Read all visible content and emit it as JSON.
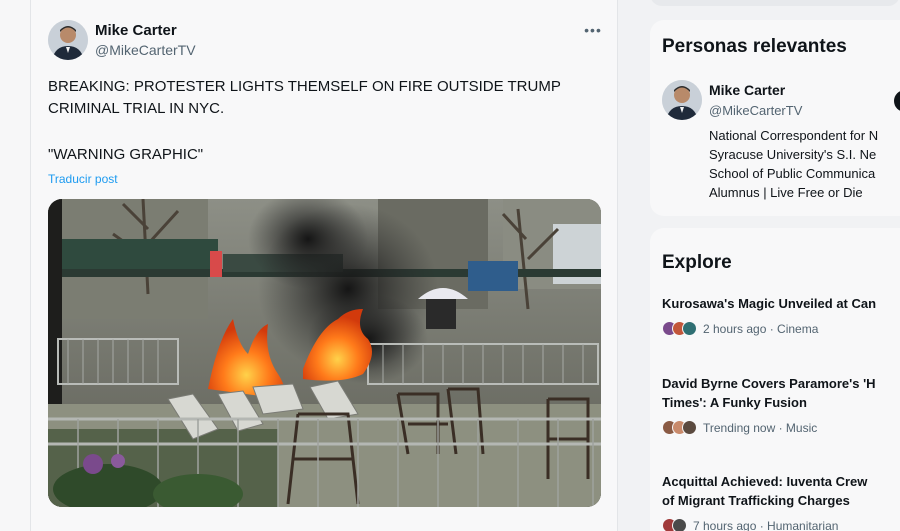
{
  "tweet": {
    "author_name": "Mike Carter",
    "author_handle": "@MikeCarterTV",
    "more_icon": "more-horizontal-icon",
    "text": "BREAKING: PROTESTER LIGHTS THEMSELF ON FIRE OUTSIDE TRUMP CRIMINAL TRIAL IN NYC.",
    "warning": "\"WARNING GRAPHIC\"",
    "translate_label": "Traducir post"
  },
  "relevant": {
    "title": "Personas relevantes",
    "person": {
      "name": "Mike Carter",
      "handle": "@MikeCarterTV",
      "bio_lines": [
        "National Correspondent for N",
        "Syracuse University's S.I. Ne",
        "School of Public Communica",
        "Alumnus | Live Free or Die"
      ]
    }
  },
  "explore": {
    "title": "Explore",
    "trends": [
      {
        "title_lines": [
          "Kurosawa's Magic Unveiled at Can"
        ],
        "meta": "2 hours ago · Cinema",
        "avatar_colors": [
          "#7a4a8c",
          "#c2563a",
          "#2f6f73"
        ]
      },
      {
        "title_lines": [
          "David Byrne Covers Paramore's 'H",
          "Times': A Funky Fusion"
        ],
        "meta": "Trending now · Music",
        "avatar_colors": [
          "#8a5a44",
          "#c98a6b",
          "#5b4a3f"
        ]
      },
      {
        "title_lines": [
          "Acquittal Achieved: Iuventa Crew",
          "of Migrant Trafficking Charges"
        ],
        "meta": "7 hours ago · Humanitarian",
        "avatar_colors": [
          "#a03a3a",
          "#4a4a4a"
        ]
      }
    ]
  }
}
